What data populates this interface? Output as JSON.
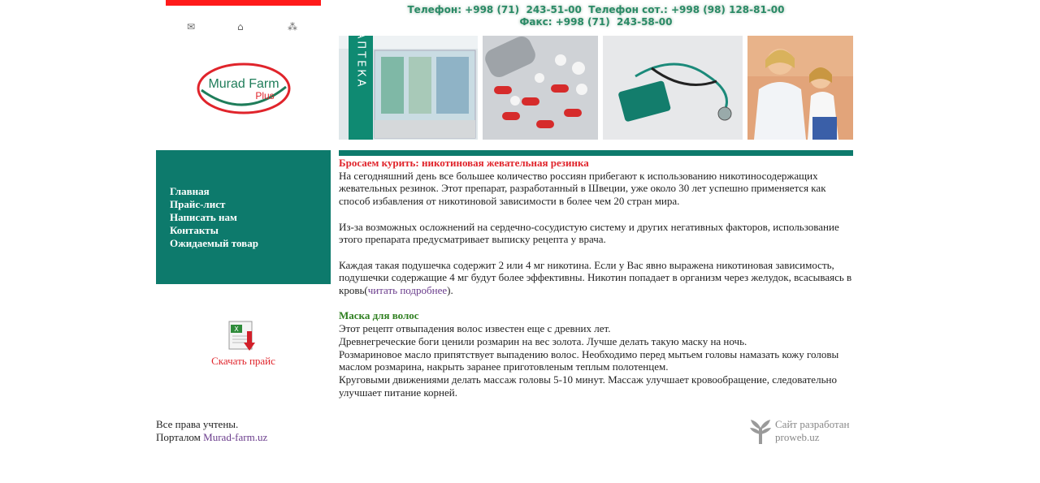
{
  "header": {
    "phones_line1": "Телефон: +998 (71)  243-51-00  Телефон сот.: +998 (98) 128-81-00",
    "phones_line2": "Факс: +998 (71)  243-58-00"
  },
  "logo": {
    "line1": "Murad Farm",
    "line2": "Plus"
  },
  "photos": {
    "pharmacy_sign": "АПТЕКА"
  },
  "menu": {
    "items": [
      {
        "label": "Главная"
      },
      {
        "label": "Прайс-лист"
      },
      {
        "label": "Написать нам"
      },
      {
        "label": "Контакты"
      },
      {
        "label": "Ожидаемый товар"
      }
    ]
  },
  "download": {
    "label": "Скачать прайс"
  },
  "article1": {
    "title": "Бросаем курить: никотиновая жевательная резинка",
    "p1": "На сегодняшний день все большее количество россиян прибегают к использованию никотиносодержащих жевательных резинок. Этот препарат, разработанный в Швеции, уже около 30 лет успешно применяется как способ избавления от никотиновой зависимости в более чем 20 стран мира.",
    "p2": "Из-за возможных осложнений на сердечно-сосудистую систему и других негативных факторов, использование этого препарата предусматривает выписку рецепта у врача.",
    "p3": "Каждая такая подушечка содержит 2 или 4 мг никотина. Если у Вас явно выражена никотиновая зависимость, подушечки содержащие 4 мг будут более эффективны. Никотин попадает в организм через желудок, всасываясь в кровь(",
    "read_more": "читать подробнее",
    "p3_end": ")."
  },
  "article2": {
    "title": "Маска для волос",
    "lines": [
      "Этот рецепт отвыпадения волос известен еще с древних лет.",
      "Древнегреческие боги ценили розмарин на вес золота. Лучше делать такую маску на ночь.",
      "Розмариновое масло припятствует выпадению волос. Необходимо перед мытьем головы намазать кожу головы маслом розмарина, накрыть заранее приготовленым теплым полотенцем.",
      "Круговыми движениями делать массаж головы 5-10 минут. Массаж улучшает кровообращение, следовательно улучшает питание корней."
    ]
  },
  "footer": {
    "rights": "Все права учтены.",
    "portal_prefix": "Порталом ",
    "portal_link": "Murad-farm.uz",
    "dev_line1": "Сайт разработан",
    "dev_line2": "proweb.uz"
  },
  "colors": {
    "accent_green": "#0d7a6c",
    "title_red": "#e0242b",
    "title_green": "#2d7e1e",
    "link_purple": "#6a3c8c"
  }
}
